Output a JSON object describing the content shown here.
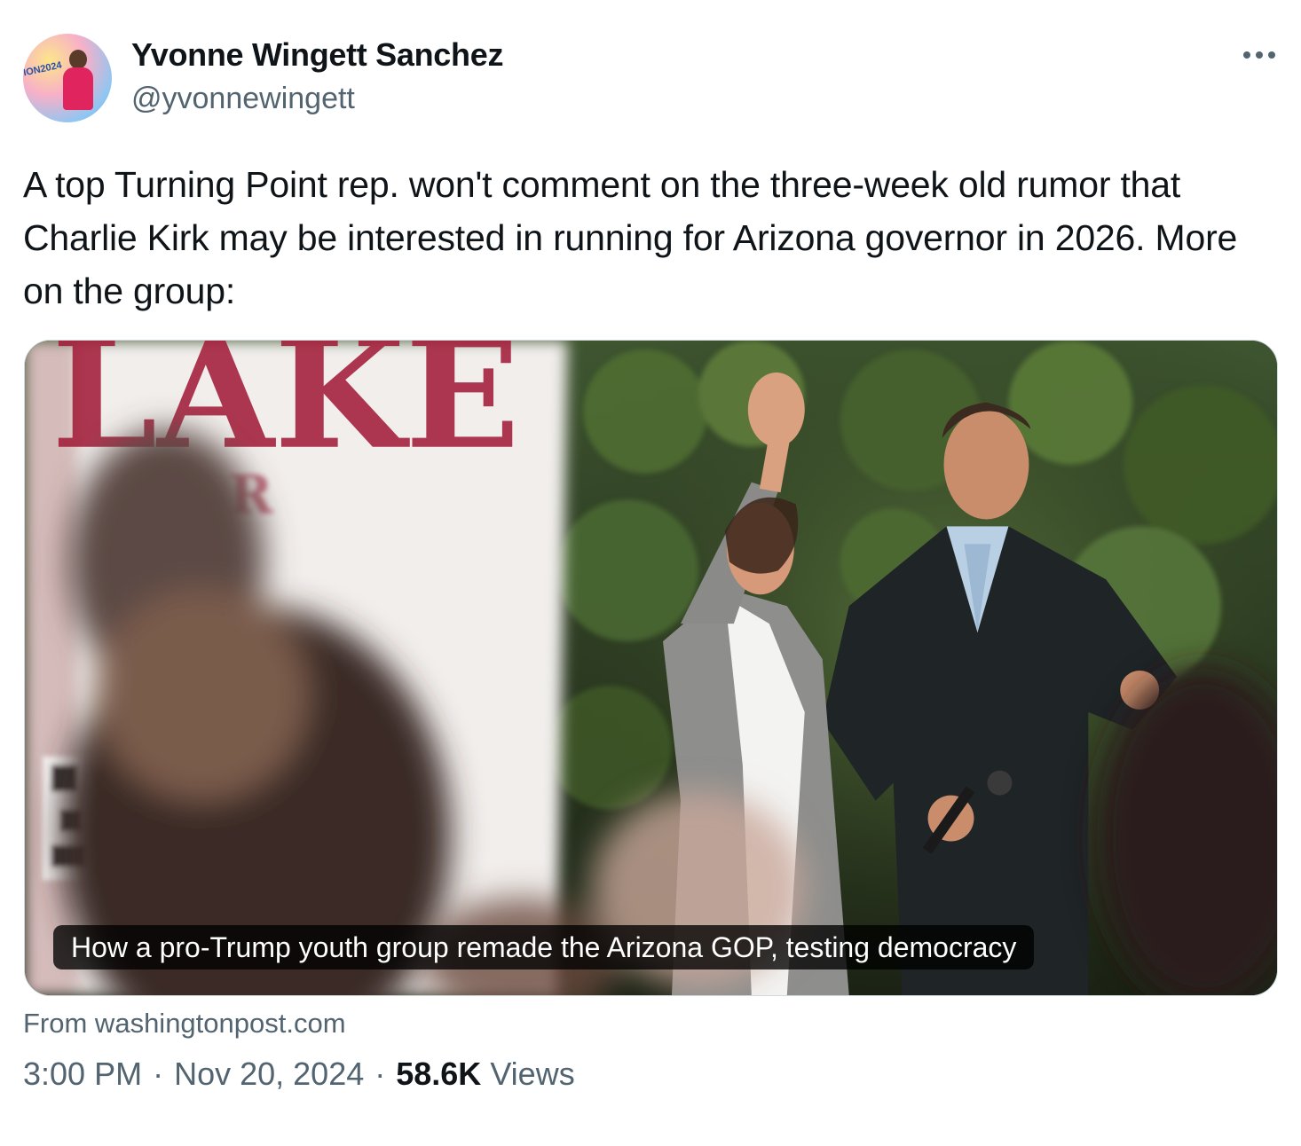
{
  "author": {
    "display_name": "Yvonne Wingett Sanchez",
    "handle": "@yvonnewingett",
    "avatar_text": "ION2024"
  },
  "tweet": {
    "text": "A top Turning Point rep. won't comment on the three-week old rumor that Charlie Kirk may be interested in running for Arizona governor in 2026. More on the group:"
  },
  "card": {
    "caption": "How a pro-Trump youth group remade the Arizona GOP, testing democracy",
    "source": "From washingtonpost.com",
    "sign_text_large": "LAKE",
    "sign_text_small": "R"
  },
  "meta": {
    "time": "3:00 PM",
    "separator": "·",
    "date": "Nov 20, 2024",
    "views_count": "58.6K",
    "views_label": "Views"
  },
  "icons": {
    "more": "more-horizontal-icon"
  },
  "colors": {
    "text_primary": "#0f1419",
    "text_secondary": "#536471",
    "border": "#cfd9de"
  }
}
